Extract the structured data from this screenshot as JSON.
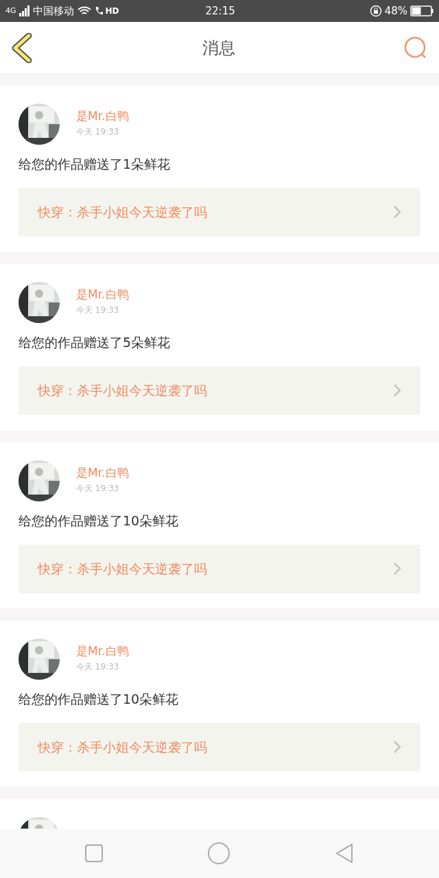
{
  "status_bar": {
    "network": "4G",
    "carrier": "中国移动",
    "call": "HD",
    "time": "22:15",
    "battery": "48%"
  },
  "header": {
    "title": "消息"
  },
  "messages": [
    {
      "kind": "message",
      "sender": "是Mr.白鸭",
      "time": "今天 19:33",
      "text": "给您的作品赠送了1朵鲜花",
      "book": "快穿：杀手小姐今天逆袭了吗"
    },
    {
      "kind": "message",
      "sender": "是Mr.白鸭",
      "time": "今天 19:33",
      "text": "给您的作品赠送了5朵鲜花",
      "book": "快穿：杀手小姐今天逆袭了吗"
    },
    {
      "kind": "message",
      "sender": "是Mr.白鸭",
      "time": "今天 19:33",
      "text": "给您的作品赠送了10朵鲜花",
      "book": "快穿：杀手小姐今天逆袭了吗"
    },
    {
      "kind": "message",
      "sender": "是Mr.白鸭",
      "time": "今天 19:33",
      "text": "给您的作品赠送了10朵鲜花",
      "book": "快穿：杀手小姐今天逆袭了吗"
    },
    {
      "kind": "partial"
    }
  ]
}
